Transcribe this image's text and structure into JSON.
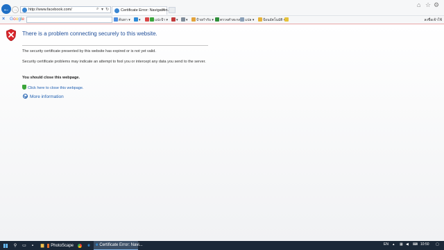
{
  "browser": {
    "address": "http://www.facebook.com/",
    "tab_title": "Certificate Error: Navigation...",
    "address_search_glyph": "⌕",
    "address_refresh_glyph": "↻"
  },
  "toolbar": {
    "google_parts": [
      "G",
      "o",
      "o",
      "g",
      "l",
      "e"
    ],
    "items": [
      "ค้นหา",
      "แปะป้า",
      "ป้ายกำกับ",
      "ตรวจคำสะกด",
      "แปล",
      "ป้อนอัตโนมัติ"
    ],
    "right_label": "ลงชื่อเข้าใช้"
  },
  "error_page": {
    "title": "There is a problem connecting securely to this website.",
    "para1": "The security certificate presented by this website has expired or is not yet valid.",
    "para2": "Security certificate problems may indicate an attempt to fool you or intercept any data you send to the server.",
    "should_close": "You should close this webpage.",
    "close_link": "Click here to close this webpage.",
    "more_info": "More information"
  },
  "taskbar": {
    "photoscape_label": "PhotoScape",
    "active_window_label": "Certificate Error: Navi...",
    "language": "EN",
    "time": "10:50"
  },
  "colors": {
    "title_blue": "#1f4e99",
    "link_blue": "#1f5fb0",
    "error_red": "#d9262b",
    "taskbar": "#1b2838"
  }
}
